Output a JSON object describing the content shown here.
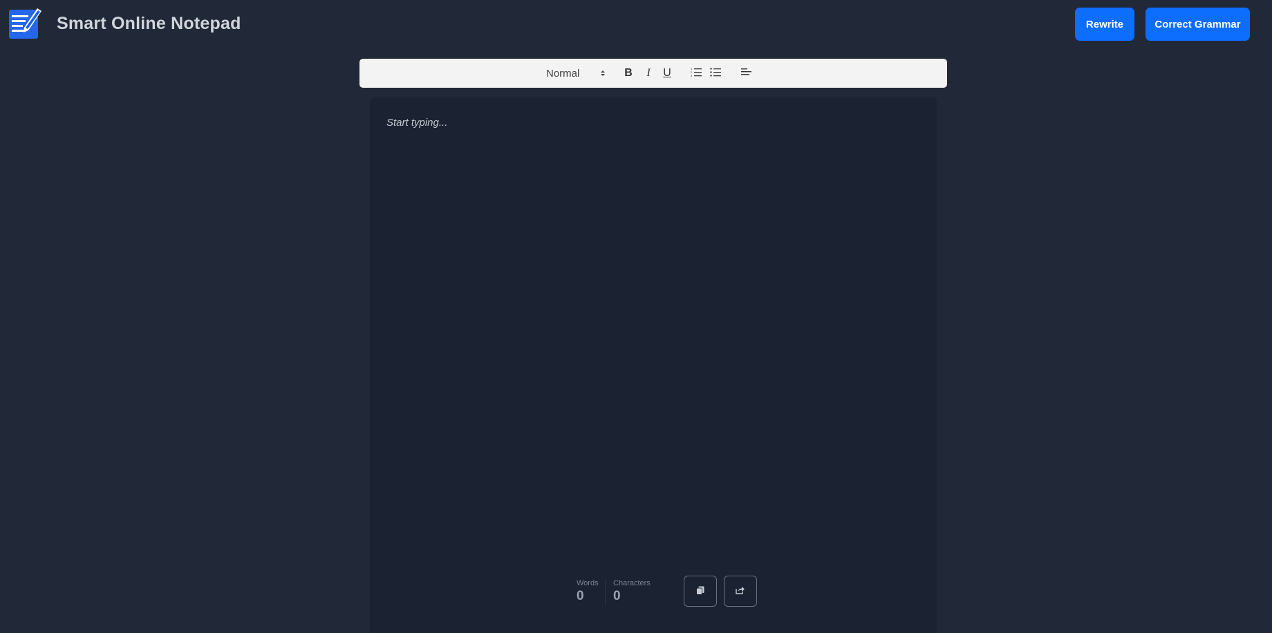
{
  "header": {
    "title": "Smart Online Notepad",
    "logo_icon": "notepad-pencil-logo",
    "rewrite_label": "Rewrite",
    "grammar_label": "Correct Grammar",
    "accent_color": "#0d6efd"
  },
  "toolbar": {
    "format_selected": "Normal",
    "bold_label": "B",
    "italic_label": "I",
    "underline_label": "U",
    "ordered_list_icon": "ordered-list-icon",
    "bullet_list_icon": "bullet-list-icon",
    "align_icon": "align-left-icon"
  },
  "editor": {
    "placeholder": "Start typing..."
  },
  "stats": {
    "words_label": "Words",
    "words_value": "0",
    "chars_label": "Characters",
    "chars_value": "0"
  },
  "actions": {
    "copy_icon": "copy-icon",
    "share_icon": "share-icon"
  }
}
